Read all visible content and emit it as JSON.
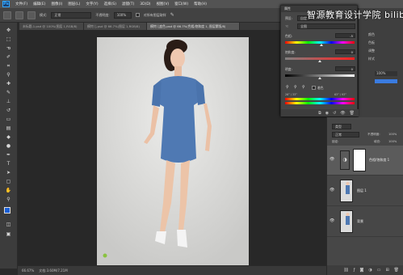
{
  "app": {
    "logo": "Ps"
  },
  "menu": [
    "文件(F)",
    "编辑(E)",
    "图像(I)",
    "图层(L)",
    "文字(Y)",
    "选择(S)",
    "滤镜(T)",
    "3D(D)",
    "视图(V)",
    "窗口(W)",
    "帮助(H)"
  ],
  "options": {
    "mode_label": "模式:",
    "mode_value": "正常",
    "opacity_label": "不透明度:",
    "opacity_value": "100%",
    "checkbox_label": "对所有图层取样"
  },
  "tabs": [
    {
      "label": "未标题-1.psd @ 100%(图层 1,RGB/8)",
      "active": false
    },
    {
      "label": "模特儿.psd @ 66.7%(图层 1,RGB/8)",
      "active": false
    },
    {
      "label": "模特儿变色.psd @ 66.7%(色相/饱和度 1, 图层蒙版/8)",
      "active": true
    }
  ],
  "status": {
    "zoom": "66.67%",
    "doc": "文档:3.60M/7.21M"
  },
  "properties": {
    "title": "属性",
    "preset_label": "预设:",
    "preset_value": "自定",
    "channel_value": "全图",
    "hue_label": "色相:",
    "hue_value": "-5",
    "saturation_label": "饱和度:",
    "saturation_value": "0",
    "lightness_label": "明度:",
    "lightness_value": "0",
    "colorize_label": "着色",
    "range_left": "26° / 33°",
    "range_right": "63° / 93°"
  },
  "right_panel": {
    "items": [
      "颜色",
      "色板",
      "调整",
      "样式"
    ],
    "value": "100%"
  },
  "layers": {
    "blend": "正常",
    "opacity_label": "不透明度:",
    "opacity_value": "100%",
    "lock_label": "锁定:",
    "fill_label": "填充:",
    "fill_value": "100%",
    "kind_label": "类型",
    "list": [
      {
        "name": "色相/饱和度 1",
        "type": "adjustment"
      },
      {
        "name": "图层 1",
        "type": "image"
      },
      {
        "name": "背景",
        "type": "image"
      }
    ]
  },
  "watermark": "智源教育设计学院 bilibili",
  "colors": {
    "accent": "#31a8ff",
    "dress": "#4f79b3",
    "fg_swatch": "#1a5fd6"
  }
}
